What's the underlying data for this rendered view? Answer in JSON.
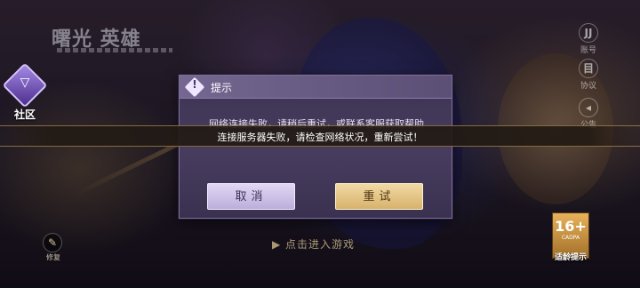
{
  "game": {
    "logo_text": "曙光 英雄"
  },
  "community": {
    "label": "社区",
    "icon": "triangle-crest-icon"
  },
  "side_buttons": [
    {
      "icon": "account-icon",
      "glyph": "JJ",
      "label": "账号"
    },
    {
      "icon": "agreement-icon",
      "glyph": "目",
      "label": "协议"
    },
    {
      "icon": "notice-icon",
      "glyph": "◂",
      "label": "公告"
    }
  ],
  "repair": {
    "icon": "wrench-icon",
    "label": "修复"
  },
  "enter_game": "▶  点击进入游戏",
  "age_rating": {
    "number": "16+",
    "label": "适龄提示"
  },
  "dialog": {
    "title": "提示",
    "message": "网络连接失败，请稍后重试，或联系客服获取帮助",
    "cancel_label": "取消",
    "retry_label": "重试"
  },
  "toast": {
    "message": "连接服务器失败，请检查网络状况，重新尝试！"
  }
}
